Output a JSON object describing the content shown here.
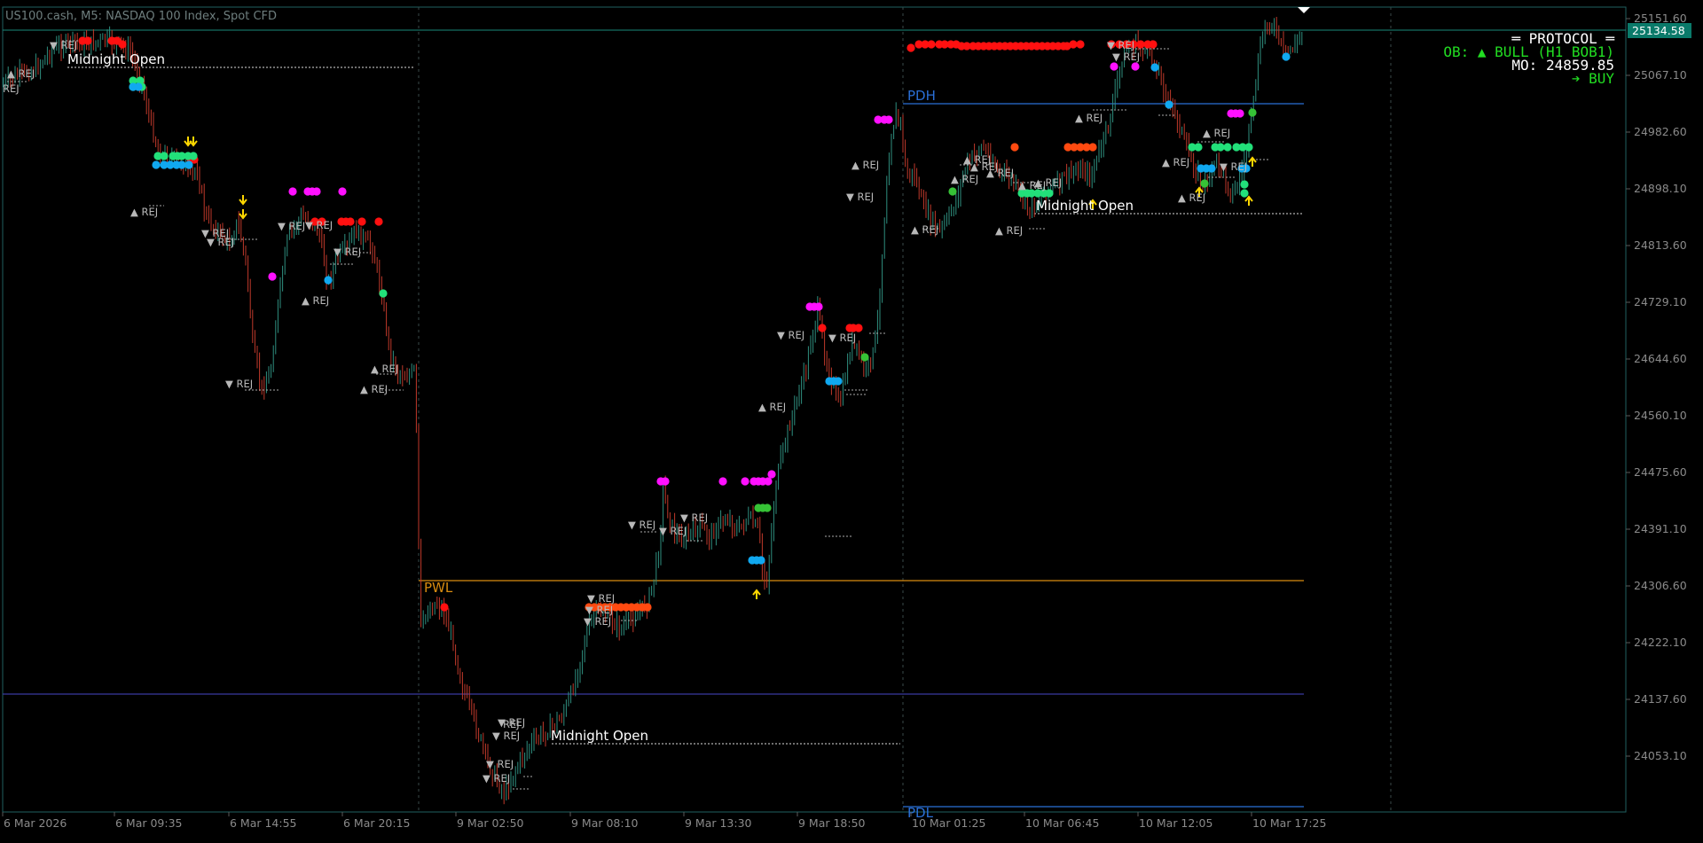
{
  "chart": {
    "title": "US100.cash, M5:  NASDAQ 100 Index, Spot CFD",
    "colors": {
      "background": "#000000",
      "frame": "#1f6f6f",
      "grid": "#2f4f4f",
      "axis_text": "#8a8a8a",
      "bull_candle": "#2f8f7f",
      "bear_candle": "#c0392b",
      "current_price_bg": "#0a7a6a"
    },
    "price_scale": [
      "25151.60",
      "25067.10",
      "24982.60",
      "24898.10",
      "24813.60",
      "24729.10",
      "24644.60",
      "24560.10",
      "24475.60",
      "24391.10",
      "24306.60",
      "24222.10",
      "24137.60",
      "24053.10"
    ],
    "current_price": "25134.58",
    "time_scale": [
      "6 Mar 2026",
      "6 Mar 09:35",
      "6 Mar 14:55",
      "6 Mar 20:15",
      "9 Mar 02:50",
      "9 Mar 08:10",
      "9 Mar 13:30",
      "9 Mar 18:50",
      "10 Mar 01:25",
      "10 Mar 06:45",
      "10 Mar 12:05",
      "10 Mar 17:25"
    ]
  },
  "levels": {
    "pdh": {
      "label": "PDH",
      "color": "#2a6fd6"
    },
    "pwl": {
      "label": "PWL",
      "color": "#d98c10"
    },
    "pdl": {
      "label": "PDL",
      "color": "#2a6fd6"
    },
    "midnight_open_label": "Midnight Open",
    "mid_line_color": "#3a3aa0"
  },
  "rej_label": "REJ",
  "rej_markers": {
    "up": "▲ REJ",
    "down": "▼ REJ"
  },
  "protocol_panel": {
    "title": "═ PROTOCOL ═",
    "ob_line": "OB: ▲ BULL (H1 BOB1)",
    "mo_line": "MO: 24859.85",
    "signal": "➔ BUY",
    "colors": {
      "title": "#ffffff",
      "ob": "#22dd22",
      "mo": "#ffffff",
      "signal": "#22dd22"
    }
  },
  "marker_colors": {
    "red": "#ff1010",
    "magenta": "#ff10ff",
    "green": "#22e07a",
    "lime": "#36c236",
    "cyan": "#10a8f0",
    "orange": "#ff4a10",
    "yellow": "#ffd700"
  }
}
